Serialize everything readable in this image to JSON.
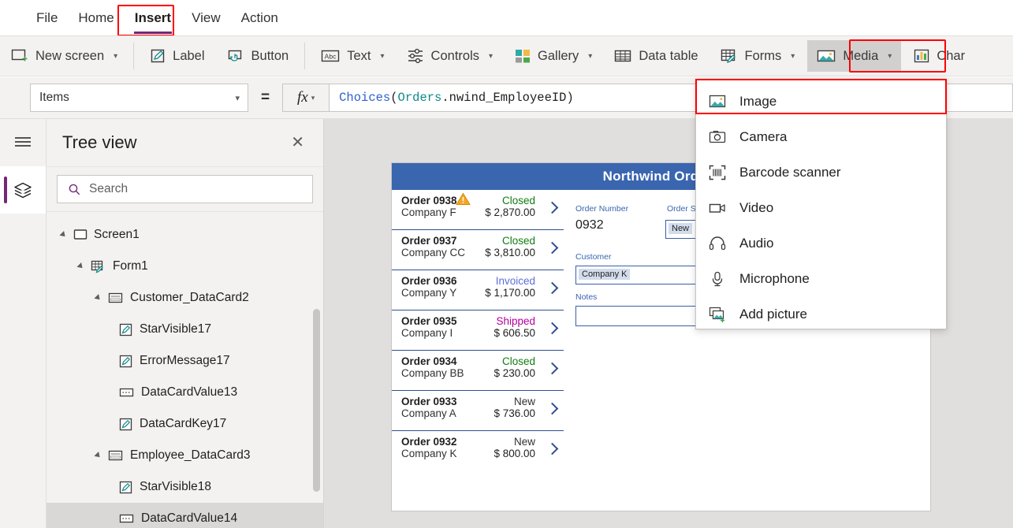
{
  "menu": {
    "items": [
      {
        "label": "File",
        "active": false
      },
      {
        "label": "Home",
        "active": false
      },
      {
        "label": "Insert",
        "active": true
      },
      {
        "label": "View",
        "active": false
      },
      {
        "label": "Action",
        "active": false
      }
    ]
  },
  "ribbon": {
    "items": [
      {
        "label": "New screen",
        "icon": "new-screen-icon",
        "caret": true,
        "selected": false
      },
      {
        "sep": true
      },
      {
        "label": "Label",
        "icon": "label-icon",
        "caret": false,
        "selected": false
      },
      {
        "label": "Button",
        "icon": "button-icon",
        "caret": false,
        "selected": false
      },
      {
        "sep": true
      },
      {
        "label": "Text",
        "icon": "text-icon",
        "caret": true,
        "selected": false
      },
      {
        "label": "Controls",
        "icon": "controls-icon",
        "caret": true,
        "selected": false
      },
      {
        "label": "Gallery",
        "icon": "gallery-icon",
        "caret": true,
        "selected": false
      },
      {
        "label": "Data table",
        "icon": "data-table-icon",
        "caret": false,
        "selected": false
      },
      {
        "label": "Forms",
        "icon": "forms-icon",
        "caret": true,
        "selected": false
      },
      {
        "label": "Media",
        "icon": "media-icon",
        "caret": true,
        "selected": true
      },
      {
        "label": "Char",
        "icon": "charts-icon",
        "caret": false,
        "selected": false
      }
    ]
  },
  "formula_bar": {
    "property": "Items",
    "equals": "=",
    "fx_label": "fx",
    "formula_tokens": [
      {
        "text": "Choices",
        "kind": "fn"
      },
      {
        "text": "(",
        "kind": "plain"
      },
      {
        "text": "Orders",
        "kind": "tbl"
      },
      {
        "text": ".nwind_EmployeeID)",
        "kind": "plain"
      }
    ],
    "formula_text": "Choices(Orders.nwind_EmployeeID)"
  },
  "tree_view": {
    "title": "Tree view",
    "close_label": "✕",
    "search_placeholder": "Search",
    "nodes": [
      {
        "label": "Screen1",
        "indent": 0,
        "icon": "screen-icon",
        "twisty": true,
        "selected": false
      },
      {
        "label": "Form1",
        "indent": 1,
        "icon": "form-icon",
        "twisty": true,
        "selected": false
      },
      {
        "label": "Customer_DataCard2",
        "indent": 2,
        "icon": "datacard-icon",
        "twisty": true,
        "selected": false
      },
      {
        "label": "StarVisible17",
        "indent": 3,
        "icon": "label-ctl-icon",
        "twisty": false,
        "selected": false
      },
      {
        "label": "ErrorMessage17",
        "indent": 3,
        "icon": "label-ctl-icon",
        "twisty": false,
        "selected": false
      },
      {
        "label": "DataCardValue13",
        "indent": 3,
        "icon": "combobox-icon",
        "twisty": false,
        "selected": false
      },
      {
        "label": "DataCardKey17",
        "indent": 3,
        "icon": "label-ctl-icon",
        "twisty": false,
        "selected": false
      },
      {
        "label": "Employee_DataCard3",
        "indent": 2,
        "icon": "datacard-icon",
        "twisty": true,
        "selected": false
      },
      {
        "label": "StarVisible18",
        "indent": 3,
        "icon": "label-ctl-icon",
        "twisty": false,
        "selected": false
      },
      {
        "label": "DataCardValue14",
        "indent": 3,
        "icon": "combobox-icon",
        "twisty": false,
        "selected": true
      }
    ]
  },
  "media_dropdown": {
    "items": [
      {
        "label": "Image",
        "icon": "image-icon",
        "highlighted": true
      },
      {
        "label": "Camera",
        "icon": "camera-icon",
        "highlighted": false
      },
      {
        "label": "Barcode scanner",
        "icon": "barcode-scanner-icon",
        "highlighted": false
      },
      {
        "label": "Video",
        "icon": "video-icon",
        "highlighted": false
      },
      {
        "label": "Audio",
        "icon": "audio-icon",
        "highlighted": false
      },
      {
        "label": "Microphone",
        "icon": "microphone-icon",
        "highlighted": false
      },
      {
        "label": "Add picture",
        "icon": "add-picture-icon",
        "highlighted": false
      }
    ]
  },
  "app_preview": {
    "header_title": "Northwind Orders",
    "gallery": [
      {
        "order": "Order 0938",
        "company": "Company F",
        "status": "Closed",
        "amount": "$ 2,870.00",
        "warning": true
      },
      {
        "order": "Order 0937",
        "company": "Company CC",
        "status": "Closed",
        "amount": "$ 3,810.00",
        "warning": false
      },
      {
        "order": "Order 0936",
        "company": "Company Y",
        "status": "Invoiced",
        "amount": "$ 1,170.00",
        "warning": false
      },
      {
        "order": "Order 0935",
        "company": "Company I",
        "status": "Shipped",
        "amount": "$ 606.50",
        "warning": false
      },
      {
        "order": "Order 0934",
        "company": "Company BB",
        "status": "Closed",
        "amount": "$ 230.00",
        "warning": false
      },
      {
        "order": "Order 0933",
        "company": "Company A",
        "status": "New",
        "amount": "$ 736.00",
        "warning": false
      },
      {
        "order": "Order 0932",
        "company": "Company K",
        "status": "New",
        "amount": "$ 800.00",
        "warning": false
      }
    ],
    "status_colors": {
      "Closed": "#107c10",
      "Invoiced": "#5b6ed6",
      "Shipped": "#b4009e",
      "New": "#323130"
    },
    "detail": {
      "order_number_label": "Order Number",
      "order_number_value": "0932",
      "order_status_label": "Order S",
      "order_status_value": "New",
      "customer_label": "Customer",
      "customer_value": "Company K",
      "notes_label": "Notes",
      "notes_value": ""
    }
  },
  "colors": {
    "accent": "#742774",
    "highlight_red": "#ff0000",
    "app_blue": "#3a66b0",
    "ribbon_bg": "#f3f2f1"
  }
}
